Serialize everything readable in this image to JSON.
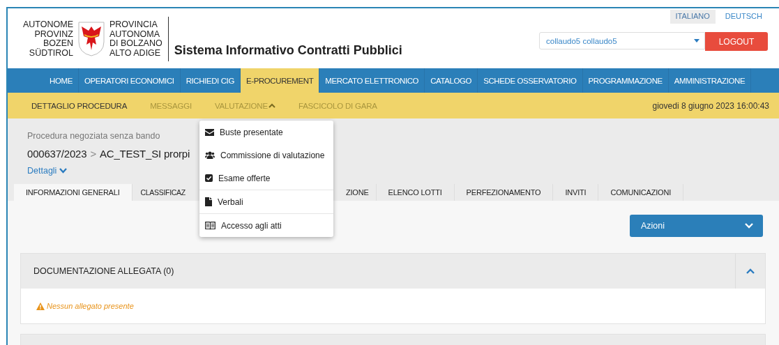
{
  "header": {
    "logo_left": [
      "AUTONOME",
      "PROVINZ",
      "BOZEN",
      "SÜDTIROL"
    ],
    "logo_right": [
      "PROVINCIA",
      "AUTONOMA",
      "DI BOLZANO",
      "ALTO ADIGE"
    ],
    "title": "Sistema Informativo Contratti Pubblici",
    "languages": [
      {
        "label": "ITALIANO",
        "selected": true
      },
      {
        "label": "DEUTSCH",
        "selected": false
      }
    ],
    "user_select": {
      "value": "collaudo5 collaudo5"
    },
    "logout": "LOGOUT"
  },
  "nav": [
    {
      "label": "HOME",
      "selected": false
    },
    {
      "label": "OPERATORI ECONOMICI",
      "selected": false
    },
    {
      "label": "RICHIEDI CIG",
      "selected": false
    },
    {
      "label": "E-PROCUREMENT",
      "selected": true
    },
    {
      "label": "MERCATO ELETTRONICO",
      "selected": false
    },
    {
      "label": "CATALOGO",
      "selected": false
    },
    {
      "label": "SCHEDE OSSERVATORIO",
      "selected": false
    },
    {
      "label": "PROGRAMMAZIONE",
      "selected": false
    },
    {
      "label": "AMMINISTRAZIONE",
      "selected": false
    }
  ],
  "subnav": {
    "items": [
      {
        "label": "DETTAGLIO PROCEDURA",
        "selected": true,
        "kind": "link"
      },
      {
        "label": "MESSAGGI",
        "selected": false,
        "kind": "link"
      },
      {
        "label": "VALUTAZIONE",
        "selected": false,
        "kind": "dropdown",
        "expanded": true
      },
      {
        "label": "FASCICOLO DI GARA",
        "selected": false,
        "kind": "link"
      }
    ],
    "date": "giovedi 8 giugno 2023 16:00:43"
  },
  "procedure": {
    "type": "Procedura negoziata senza bando",
    "number": "000637/2023",
    "separator": ">",
    "title": "AC_TEST_SI prorpi",
    "details": "Dettagli"
  },
  "dropdown_menu": {
    "groups": [
      [
        {
          "label": "Buste presentate"
        },
        {
          "label": "Commissione di valutazione"
        },
        {
          "label": "Esame offerte"
        }
      ],
      [
        {
          "label": "Verbali"
        }
      ],
      [
        {
          "label": "Accesso agli atti"
        }
      ]
    ]
  },
  "tabs": [
    {
      "label": "INFORMAZIONI GENERALI",
      "selected": true
    },
    {
      "label": "CLASSIFICAZ",
      "selected": false
    },
    {
      "label": "ZIONE",
      "selected": false
    },
    {
      "label": "ELENCO LOTTI",
      "selected": false
    },
    {
      "label": "PERFEZIONAMENTO",
      "selected": false
    },
    {
      "label": "INVITI",
      "selected": false
    },
    {
      "label": "COMUNICAZIONI",
      "selected": false
    }
  ],
  "actions_button": "Azioni",
  "panel": {
    "title": "DOCUMENTAZIONE ALLEGATA (0)",
    "expanded": true,
    "message": "Nessun allegato presente"
  }
}
